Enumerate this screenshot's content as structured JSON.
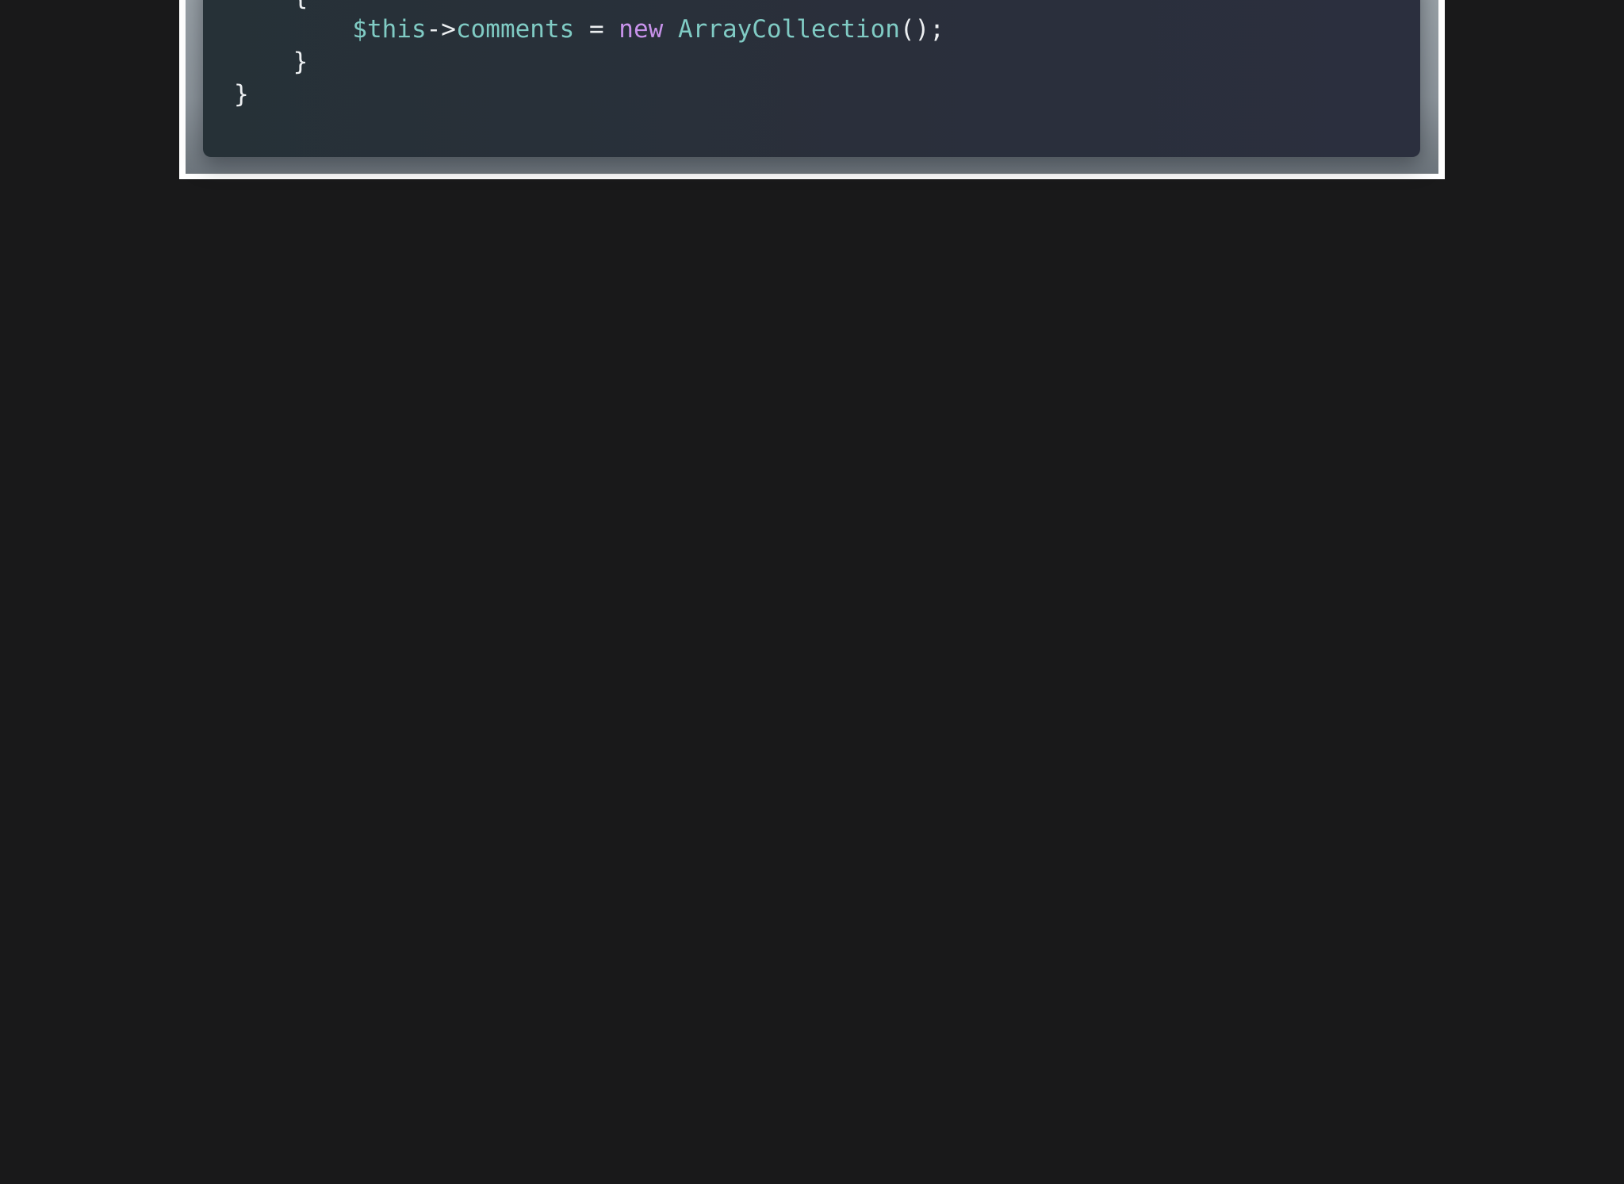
{
  "colors": {
    "page_background": "#19191a",
    "frame": "#ffffff",
    "code_background": "#2a2f3b",
    "variable": "#80cbc4",
    "keyword": "#c792ea",
    "class_name": "#80cbc4",
    "punctuation": "#eceff1"
  },
  "code": {
    "language": "php",
    "lines": [
      {
        "indent": "    ",
        "tokens": [
          {
            "type": "punc",
            "text": "{"
          }
        ]
      },
      {
        "indent": "        ",
        "tokens": [
          {
            "type": "var",
            "text": "$this"
          },
          {
            "type": "punc",
            "text": "->"
          },
          {
            "type": "var",
            "text": "comments"
          },
          {
            "type": "punc",
            "text": " = "
          },
          {
            "type": "kw",
            "text": "new"
          },
          {
            "type": "punc",
            "text": " "
          },
          {
            "type": "cls",
            "text": "ArrayCollection"
          },
          {
            "type": "punc",
            "text": "();"
          }
        ]
      },
      {
        "indent": "    ",
        "tokens": [
          {
            "type": "punc",
            "text": "}"
          }
        ]
      },
      {
        "indent": "",
        "tokens": [
          {
            "type": "punc",
            "text": "}"
          }
        ]
      }
    ]
  }
}
